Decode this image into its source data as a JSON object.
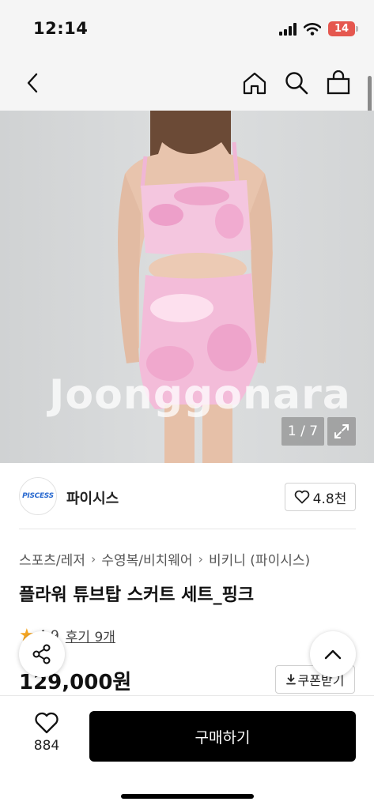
{
  "status_bar": {
    "time": "12:14",
    "battery": "14"
  },
  "nav": {
    "icons": [
      "back-icon",
      "home-icon",
      "search-icon",
      "cart-icon"
    ]
  },
  "product_image": {
    "watermark": "Joonggonara",
    "counter": "1 / 7"
  },
  "seller": {
    "logo_text": "PISCESS",
    "name": "파이시스",
    "likes": "4.8천"
  },
  "breadcrumb": [
    "스포츠/레저",
    "수영복/비치웨어",
    "비키니 (파이시스)"
  ],
  "product": {
    "title": "플라워 튜브탑 스커트 세트_핑크",
    "rating": "4.9",
    "reviews": "후기 9개",
    "price": "129,000원",
    "coupon_label": "쿠폰받기"
  },
  "bottom_bar": {
    "wish_count": "884",
    "buy_label": "구매하기"
  },
  "colors": {
    "accent": "#000000",
    "star": "#f5a623",
    "battery": "#e5574f",
    "garment": "#f0b6d6"
  }
}
